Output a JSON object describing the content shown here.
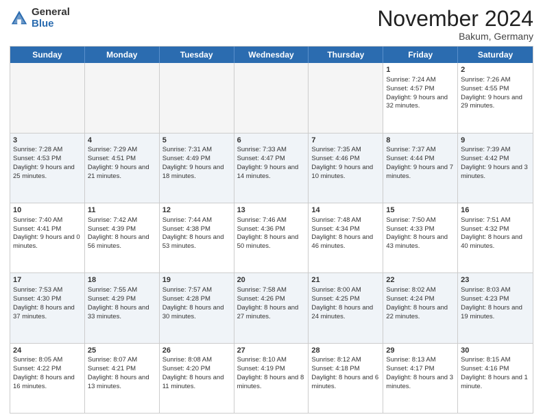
{
  "header": {
    "logo_general": "General",
    "logo_blue": "Blue",
    "title": "November 2024",
    "location": "Bakum, Germany"
  },
  "weekdays": [
    "Sunday",
    "Monday",
    "Tuesday",
    "Wednesday",
    "Thursday",
    "Friday",
    "Saturday"
  ],
  "rows": [
    [
      {
        "day": "",
        "info": "",
        "empty": true
      },
      {
        "day": "",
        "info": "",
        "empty": true
      },
      {
        "day": "",
        "info": "",
        "empty": true
      },
      {
        "day": "",
        "info": "",
        "empty": true
      },
      {
        "day": "",
        "info": "",
        "empty": true
      },
      {
        "day": "1",
        "info": "Sunrise: 7:24 AM\nSunset: 4:57 PM\nDaylight: 9 hours and 32 minutes."
      },
      {
        "day": "2",
        "info": "Sunrise: 7:26 AM\nSunset: 4:55 PM\nDaylight: 9 hours and 29 minutes."
      }
    ],
    [
      {
        "day": "3",
        "info": "Sunrise: 7:28 AM\nSunset: 4:53 PM\nDaylight: 9 hours and 25 minutes."
      },
      {
        "day": "4",
        "info": "Sunrise: 7:29 AM\nSunset: 4:51 PM\nDaylight: 9 hours and 21 minutes."
      },
      {
        "day": "5",
        "info": "Sunrise: 7:31 AM\nSunset: 4:49 PM\nDaylight: 9 hours and 18 minutes."
      },
      {
        "day": "6",
        "info": "Sunrise: 7:33 AM\nSunset: 4:47 PM\nDaylight: 9 hours and 14 minutes."
      },
      {
        "day": "7",
        "info": "Sunrise: 7:35 AM\nSunset: 4:46 PM\nDaylight: 9 hours and 10 minutes."
      },
      {
        "day": "8",
        "info": "Sunrise: 7:37 AM\nSunset: 4:44 PM\nDaylight: 9 hours and 7 minutes."
      },
      {
        "day": "9",
        "info": "Sunrise: 7:39 AM\nSunset: 4:42 PM\nDaylight: 9 hours and 3 minutes."
      }
    ],
    [
      {
        "day": "10",
        "info": "Sunrise: 7:40 AM\nSunset: 4:41 PM\nDaylight: 9 hours and 0 minutes."
      },
      {
        "day": "11",
        "info": "Sunrise: 7:42 AM\nSunset: 4:39 PM\nDaylight: 8 hours and 56 minutes."
      },
      {
        "day": "12",
        "info": "Sunrise: 7:44 AM\nSunset: 4:38 PM\nDaylight: 8 hours and 53 minutes."
      },
      {
        "day": "13",
        "info": "Sunrise: 7:46 AM\nSunset: 4:36 PM\nDaylight: 8 hours and 50 minutes."
      },
      {
        "day": "14",
        "info": "Sunrise: 7:48 AM\nSunset: 4:34 PM\nDaylight: 8 hours and 46 minutes."
      },
      {
        "day": "15",
        "info": "Sunrise: 7:50 AM\nSunset: 4:33 PM\nDaylight: 8 hours and 43 minutes."
      },
      {
        "day": "16",
        "info": "Sunrise: 7:51 AM\nSunset: 4:32 PM\nDaylight: 8 hours and 40 minutes."
      }
    ],
    [
      {
        "day": "17",
        "info": "Sunrise: 7:53 AM\nSunset: 4:30 PM\nDaylight: 8 hours and 37 minutes."
      },
      {
        "day": "18",
        "info": "Sunrise: 7:55 AM\nSunset: 4:29 PM\nDaylight: 8 hours and 33 minutes."
      },
      {
        "day": "19",
        "info": "Sunrise: 7:57 AM\nSunset: 4:28 PM\nDaylight: 8 hours and 30 minutes."
      },
      {
        "day": "20",
        "info": "Sunrise: 7:58 AM\nSunset: 4:26 PM\nDaylight: 8 hours and 27 minutes."
      },
      {
        "day": "21",
        "info": "Sunrise: 8:00 AM\nSunset: 4:25 PM\nDaylight: 8 hours and 24 minutes."
      },
      {
        "day": "22",
        "info": "Sunrise: 8:02 AM\nSunset: 4:24 PM\nDaylight: 8 hours and 22 minutes."
      },
      {
        "day": "23",
        "info": "Sunrise: 8:03 AM\nSunset: 4:23 PM\nDaylight: 8 hours and 19 minutes."
      }
    ],
    [
      {
        "day": "24",
        "info": "Sunrise: 8:05 AM\nSunset: 4:22 PM\nDaylight: 8 hours and 16 minutes."
      },
      {
        "day": "25",
        "info": "Sunrise: 8:07 AM\nSunset: 4:21 PM\nDaylight: 8 hours and 13 minutes."
      },
      {
        "day": "26",
        "info": "Sunrise: 8:08 AM\nSunset: 4:20 PM\nDaylight: 8 hours and 11 minutes."
      },
      {
        "day": "27",
        "info": "Sunrise: 8:10 AM\nSunset: 4:19 PM\nDaylight: 8 hours and 8 minutes."
      },
      {
        "day": "28",
        "info": "Sunrise: 8:12 AM\nSunset: 4:18 PM\nDaylight: 8 hours and 6 minutes."
      },
      {
        "day": "29",
        "info": "Sunrise: 8:13 AM\nSunset: 4:17 PM\nDaylight: 8 hours and 3 minutes."
      },
      {
        "day": "30",
        "info": "Sunrise: 8:15 AM\nSunset: 4:16 PM\nDaylight: 8 hours and 1 minute."
      }
    ]
  ]
}
